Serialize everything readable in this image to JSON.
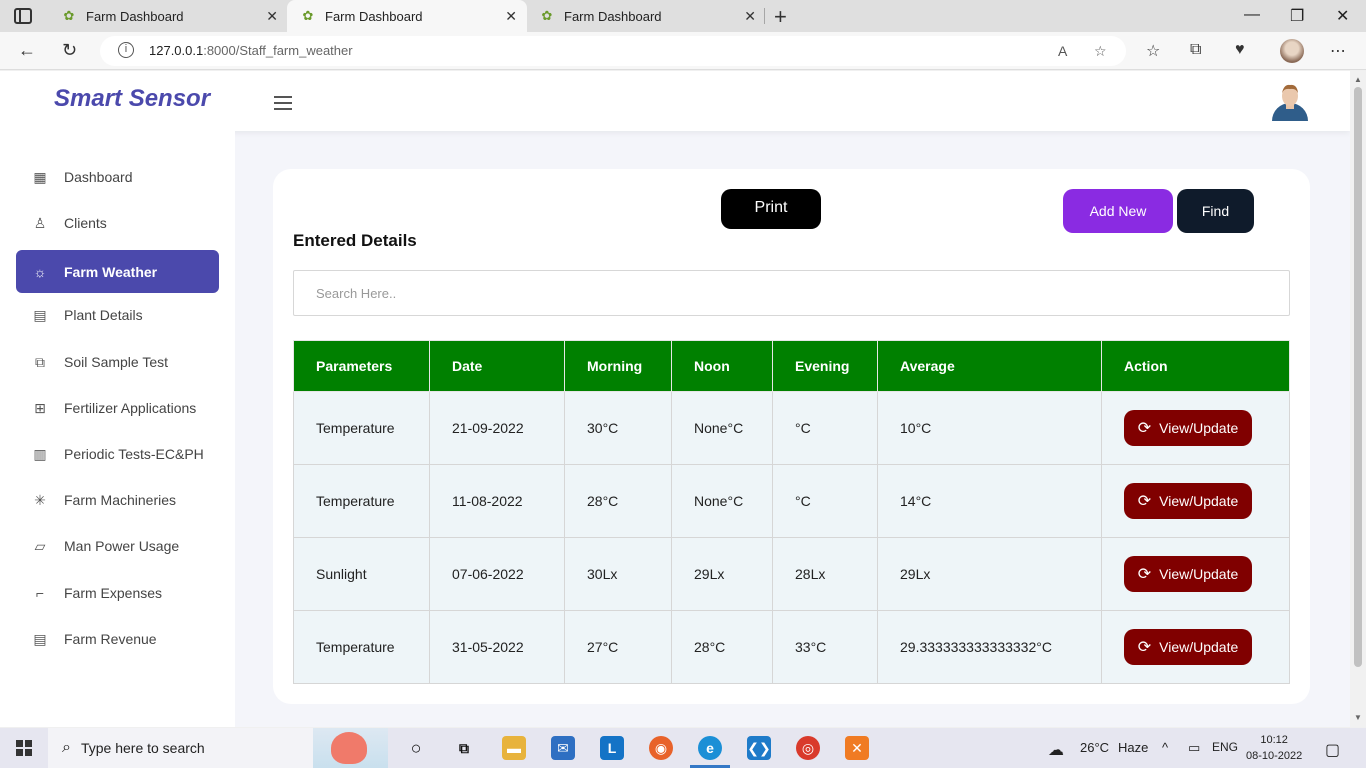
{
  "browser": {
    "tabs": [
      {
        "title": "Farm Dashboard",
        "active": false
      },
      {
        "title": "Farm Dashboard",
        "active": true
      },
      {
        "title": "Farm Dashboard",
        "active": false
      }
    ],
    "url_host": "127.0.0.1",
    "url_path": ":8000/Staff_farm_weather"
  },
  "app": {
    "brand": "Smart Sensor",
    "brand_color": "#4b49ac"
  },
  "sidebar": {
    "items": [
      {
        "label": "Dashboard",
        "icon": "grid-icon"
      },
      {
        "label": "Clients",
        "icon": "user-icon"
      },
      {
        "label": "Farm Weather",
        "icon": "sun-icon",
        "active": true
      },
      {
        "label": "Plant Details",
        "icon": "layout-icon"
      },
      {
        "label": "Soil Sample Test",
        "icon": "external-link-icon"
      },
      {
        "label": "Fertilizer Applications",
        "icon": "grid-square-icon"
      },
      {
        "label": "Periodic Tests-EC&PH",
        "icon": "columns-icon"
      },
      {
        "label": "Farm Machineries",
        "icon": "loader-icon"
      },
      {
        "label": "Man Power Usage",
        "icon": "map-icon"
      },
      {
        "label": "Farm Expenses",
        "icon": "minimize-icon"
      },
      {
        "label": "Farm Revenue",
        "icon": "file-text-icon"
      }
    ]
  },
  "main": {
    "print_label": "Print",
    "add_new_label": "Add New",
    "find_label": "Find",
    "section_title": "Entered Details",
    "search_placeholder": "Search Here..",
    "table": {
      "headers": [
        "Parameters",
        "Date",
        "Morning",
        "Noon",
        "Evening",
        "Average",
        "Action"
      ],
      "rows": [
        {
          "parameter": "Temperature",
          "date": "21-09-2022",
          "morning": "30°C",
          "noon": "None°C",
          "evening": "°C",
          "average": "10°C",
          "action": "View/Update"
        },
        {
          "parameter": "Temperature",
          "date": "11-08-2022",
          "morning": "28°C",
          "noon": "None°C",
          "evening": "°C",
          "average": "14°C",
          "action": "View/Update"
        },
        {
          "parameter": "Sunlight",
          "date": "07-06-2022",
          "morning": "30Lx",
          "noon": "29Lx",
          "evening": "28Lx",
          "average": "29Lx",
          "action": "View/Update"
        },
        {
          "parameter": "Temperature",
          "date": "31-05-2022",
          "morning": "27°C",
          "noon": "28°C",
          "evening": "33°C",
          "average": "29.333333333333332°C",
          "action": "View/Update"
        }
      ]
    },
    "colors": {
      "header_green": "#008000",
      "action_maroon": "#800000",
      "add_purple": "#8a2be2"
    }
  },
  "taskbar": {
    "search_placeholder": "Type here to search",
    "weather": "26°C",
    "weather_desc": "Haze",
    "lang": "ENG",
    "time": "10:12",
    "date": "08-10-2022"
  }
}
